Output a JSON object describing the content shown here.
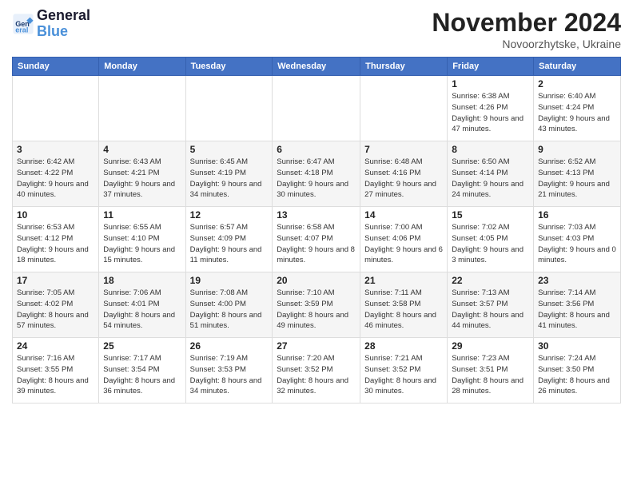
{
  "header": {
    "logo_general": "General",
    "logo_blue": "Blue",
    "month_title": "November 2024",
    "subtitle": "Novoorzhytske, Ukraine"
  },
  "calendar": {
    "days_of_week": [
      "Sunday",
      "Monday",
      "Tuesday",
      "Wednesday",
      "Thursday",
      "Friday",
      "Saturday"
    ],
    "weeks": [
      [
        {
          "day": "",
          "info": ""
        },
        {
          "day": "",
          "info": ""
        },
        {
          "day": "",
          "info": ""
        },
        {
          "day": "",
          "info": ""
        },
        {
          "day": "",
          "info": ""
        },
        {
          "day": "1",
          "info": "Sunrise: 6:38 AM\nSunset: 4:26 PM\nDaylight: 9 hours and 47 minutes."
        },
        {
          "day": "2",
          "info": "Sunrise: 6:40 AM\nSunset: 4:24 PM\nDaylight: 9 hours and 43 minutes."
        }
      ],
      [
        {
          "day": "3",
          "info": "Sunrise: 6:42 AM\nSunset: 4:22 PM\nDaylight: 9 hours and 40 minutes."
        },
        {
          "day": "4",
          "info": "Sunrise: 6:43 AM\nSunset: 4:21 PM\nDaylight: 9 hours and 37 minutes."
        },
        {
          "day": "5",
          "info": "Sunrise: 6:45 AM\nSunset: 4:19 PM\nDaylight: 9 hours and 34 minutes."
        },
        {
          "day": "6",
          "info": "Sunrise: 6:47 AM\nSunset: 4:18 PM\nDaylight: 9 hours and 30 minutes."
        },
        {
          "day": "7",
          "info": "Sunrise: 6:48 AM\nSunset: 4:16 PM\nDaylight: 9 hours and 27 minutes."
        },
        {
          "day": "8",
          "info": "Sunrise: 6:50 AM\nSunset: 4:14 PM\nDaylight: 9 hours and 24 minutes."
        },
        {
          "day": "9",
          "info": "Sunrise: 6:52 AM\nSunset: 4:13 PM\nDaylight: 9 hours and 21 minutes."
        }
      ],
      [
        {
          "day": "10",
          "info": "Sunrise: 6:53 AM\nSunset: 4:12 PM\nDaylight: 9 hours and 18 minutes."
        },
        {
          "day": "11",
          "info": "Sunrise: 6:55 AM\nSunset: 4:10 PM\nDaylight: 9 hours and 15 minutes."
        },
        {
          "day": "12",
          "info": "Sunrise: 6:57 AM\nSunset: 4:09 PM\nDaylight: 9 hours and 11 minutes."
        },
        {
          "day": "13",
          "info": "Sunrise: 6:58 AM\nSunset: 4:07 PM\nDaylight: 9 hours and 8 minutes."
        },
        {
          "day": "14",
          "info": "Sunrise: 7:00 AM\nSunset: 4:06 PM\nDaylight: 9 hours and 6 minutes."
        },
        {
          "day": "15",
          "info": "Sunrise: 7:02 AM\nSunset: 4:05 PM\nDaylight: 9 hours and 3 minutes."
        },
        {
          "day": "16",
          "info": "Sunrise: 7:03 AM\nSunset: 4:03 PM\nDaylight: 9 hours and 0 minutes."
        }
      ],
      [
        {
          "day": "17",
          "info": "Sunrise: 7:05 AM\nSunset: 4:02 PM\nDaylight: 8 hours and 57 minutes."
        },
        {
          "day": "18",
          "info": "Sunrise: 7:06 AM\nSunset: 4:01 PM\nDaylight: 8 hours and 54 minutes."
        },
        {
          "day": "19",
          "info": "Sunrise: 7:08 AM\nSunset: 4:00 PM\nDaylight: 8 hours and 51 minutes."
        },
        {
          "day": "20",
          "info": "Sunrise: 7:10 AM\nSunset: 3:59 PM\nDaylight: 8 hours and 49 minutes."
        },
        {
          "day": "21",
          "info": "Sunrise: 7:11 AM\nSunset: 3:58 PM\nDaylight: 8 hours and 46 minutes."
        },
        {
          "day": "22",
          "info": "Sunrise: 7:13 AM\nSunset: 3:57 PM\nDaylight: 8 hours and 44 minutes."
        },
        {
          "day": "23",
          "info": "Sunrise: 7:14 AM\nSunset: 3:56 PM\nDaylight: 8 hours and 41 minutes."
        }
      ],
      [
        {
          "day": "24",
          "info": "Sunrise: 7:16 AM\nSunset: 3:55 PM\nDaylight: 8 hours and 39 minutes."
        },
        {
          "day": "25",
          "info": "Sunrise: 7:17 AM\nSunset: 3:54 PM\nDaylight: 8 hours and 36 minutes."
        },
        {
          "day": "26",
          "info": "Sunrise: 7:19 AM\nSunset: 3:53 PM\nDaylight: 8 hours and 34 minutes."
        },
        {
          "day": "27",
          "info": "Sunrise: 7:20 AM\nSunset: 3:52 PM\nDaylight: 8 hours and 32 minutes."
        },
        {
          "day": "28",
          "info": "Sunrise: 7:21 AM\nSunset: 3:52 PM\nDaylight: 8 hours and 30 minutes."
        },
        {
          "day": "29",
          "info": "Sunrise: 7:23 AM\nSunset: 3:51 PM\nDaylight: 8 hours and 28 minutes."
        },
        {
          "day": "30",
          "info": "Sunrise: 7:24 AM\nSunset: 3:50 PM\nDaylight: 8 hours and 26 minutes."
        }
      ]
    ]
  }
}
